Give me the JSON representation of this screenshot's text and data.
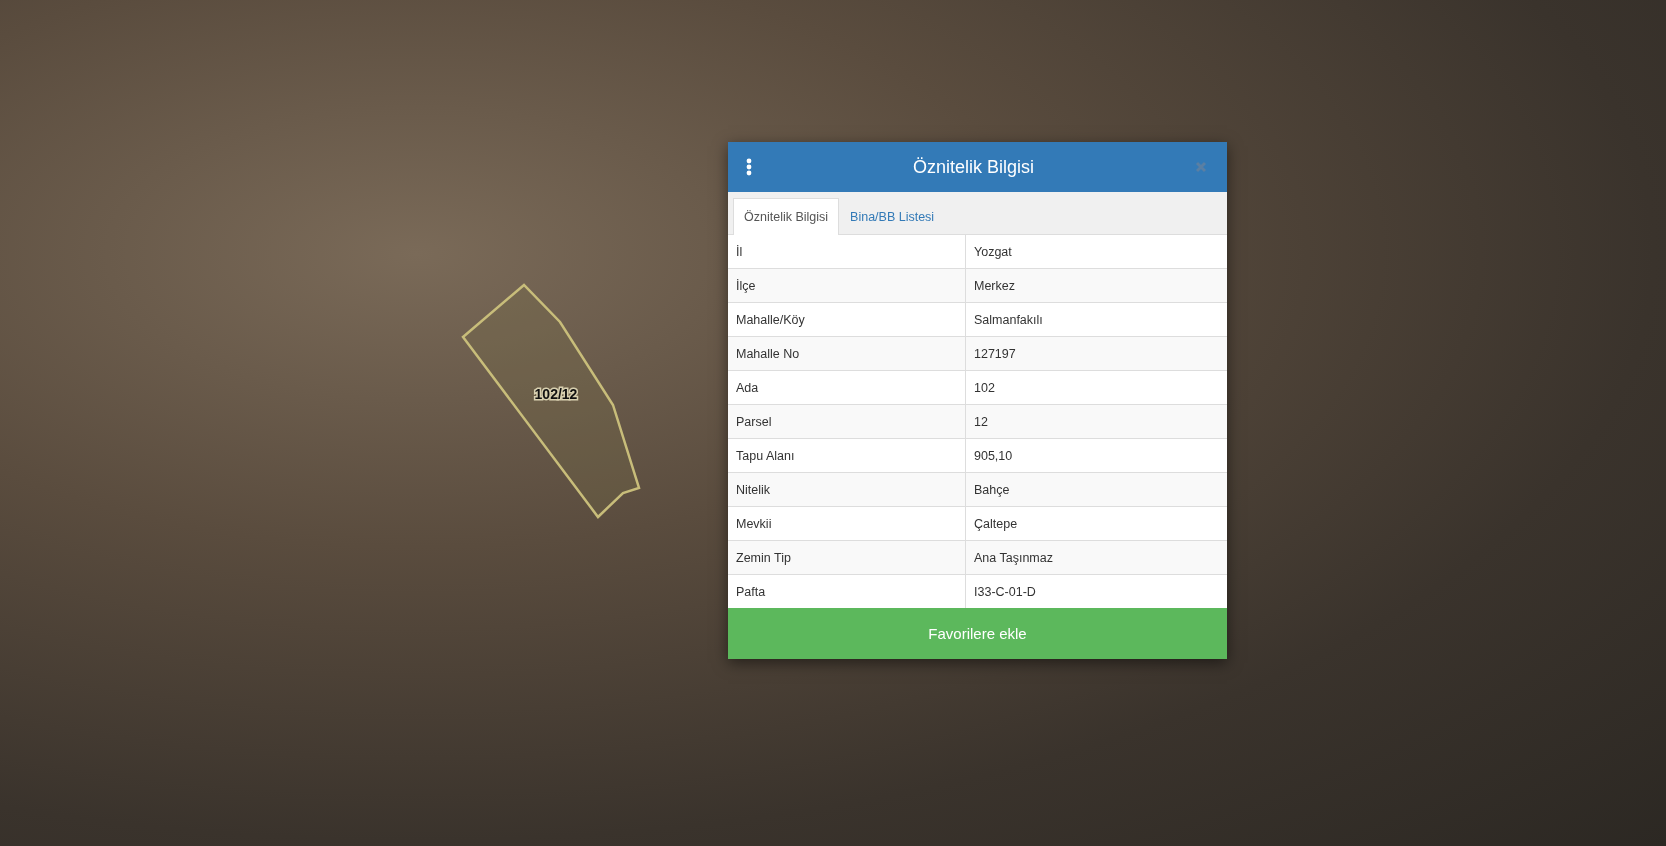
{
  "map": {
    "parcel_label": "102/12"
  },
  "dialog": {
    "title": "Öznitelik Bilgisi",
    "tabs": [
      {
        "label": "Öznitelik Bilgisi",
        "selected": true
      },
      {
        "label": "Bina/BB Listesi",
        "selected": false
      }
    ],
    "rows": [
      {
        "label": "İl",
        "value": "Yozgat"
      },
      {
        "label": "İlçe",
        "value": "Merkez"
      },
      {
        "label": "Mahalle/Köy",
        "value": "Salmanfakılı"
      },
      {
        "label": "Mahalle No",
        "value": "127197"
      },
      {
        "label": "Ada",
        "value": "102"
      },
      {
        "label": "Parsel",
        "value": "12"
      },
      {
        "label": "Tapu Alanı",
        "value": "905,10"
      },
      {
        "label": "Nitelik",
        "value": "Bahçe"
      },
      {
        "label": "Mevkii",
        "value": "Çaltepe"
      },
      {
        "label": "Zemin Tip",
        "value": "Ana Taşınmaz"
      },
      {
        "label": "Pafta",
        "value": "I33-C-01-D"
      }
    ],
    "button": "Favorilere ekle"
  }
}
